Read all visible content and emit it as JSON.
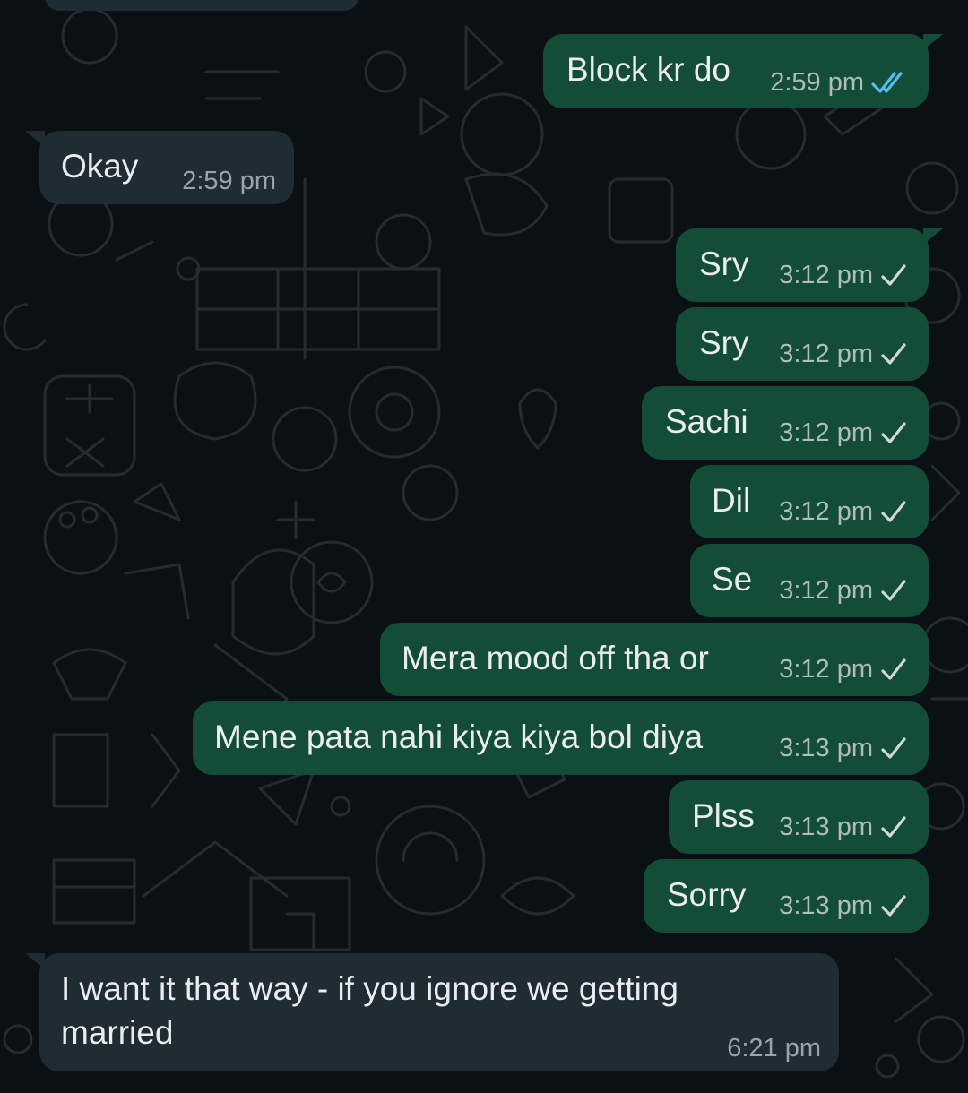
{
  "colors": {
    "background": "#0b1014",
    "outgoing_bubble": "#144d37",
    "incoming_bubble": "#1f2c33",
    "text": "#e9edef",
    "read_tick": "#53bdeb",
    "sent_tick": "#d1d7db"
  },
  "messages": [
    {
      "text": "Block kr do",
      "time": "2:59 pm",
      "direction": "out",
      "status": "read-double-tick-icon"
    },
    {
      "text": "Okay",
      "time": "2:59 pm",
      "direction": "in"
    },
    {
      "text": "Sry",
      "time": "3:12 pm",
      "direction": "out",
      "status": "sent-single-tick-icon"
    },
    {
      "text": "Sry",
      "time": "3:12 pm",
      "direction": "out",
      "status": "sent-single-tick-icon"
    },
    {
      "text": "Sachi",
      "time": "3:12 pm",
      "direction": "out",
      "status": "sent-single-tick-icon"
    },
    {
      "text": "Dil",
      "time": "3:12 pm",
      "direction": "out",
      "status": "sent-single-tick-icon"
    },
    {
      "text": "Se",
      "time": "3:12 pm",
      "direction": "out",
      "status": "sent-single-tick-icon"
    },
    {
      "text": "Mera mood off tha or",
      "time": "3:12 pm",
      "direction": "out",
      "status": "sent-single-tick-icon"
    },
    {
      "text": "Mene pata nahi kiya kiya bol diya",
      "time": "3:13 pm",
      "direction": "out",
      "status": "sent-single-tick-icon"
    },
    {
      "text": "Plss",
      "time": "3:13 pm",
      "direction": "out",
      "status": "sent-single-tick-icon"
    },
    {
      "text": "Sorry",
      "time": "3:13 pm",
      "direction": "out",
      "status": "sent-single-tick-icon"
    },
    {
      "text_line1": "I want it that way - if you ignore we getting",
      "text_line2": "married",
      "time": "6:21 pm",
      "direction": "in"
    }
  ]
}
